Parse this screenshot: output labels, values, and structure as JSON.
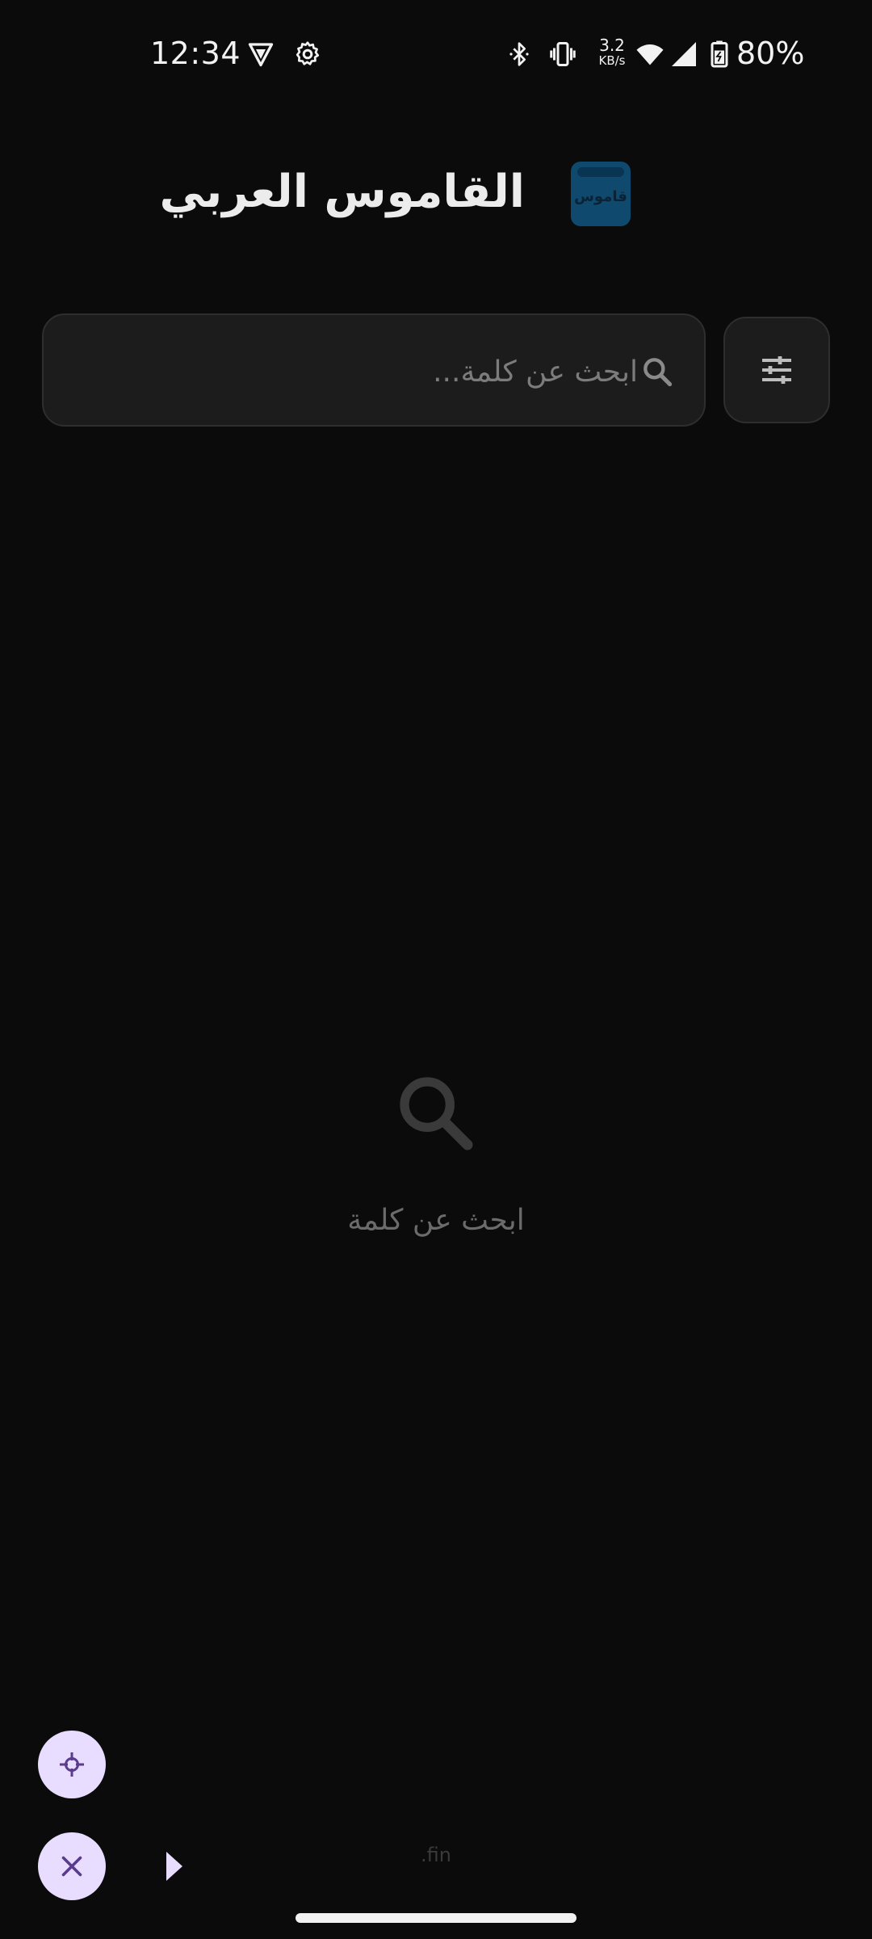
{
  "status_bar": {
    "time": "12:34",
    "net_speed_value": "3.2",
    "net_speed_unit": "KB/s",
    "battery": "80%",
    "icons": [
      "vpn-icon",
      "settings-icon",
      "bluetooth-icon",
      "vibrate-icon",
      "wifi-icon",
      "cell-signal-icon",
      "battery-icon"
    ]
  },
  "header": {
    "title": "القاموس العربي",
    "logo_text": "قاموس",
    "logo_color": "#0f4a6e"
  },
  "search": {
    "placeholder": "ابحث عن كلمة...",
    "value": ""
  },
  "empty_state": {
    "message": "ابحث عن كلمة"
  },
  "footer": {
    "label": ".fin"
  },
  "colors": {
    "background": "#0b0b0b",
    "fab": "#e9ddff",
    "fab_icon": "#5a3c8f"
  }
}
